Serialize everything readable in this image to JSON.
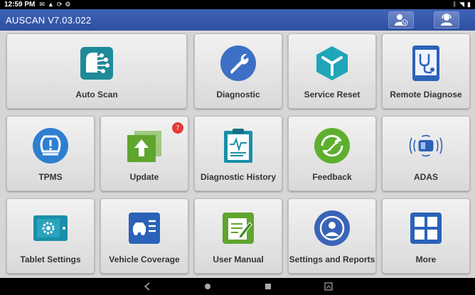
{
  "status_bar": {
    "time": "12:59 PM",
    "icons": [
      "mail-icon",
      "warning-icon",
      "sync-icon",
      "settings-icon"
    ],
    "right_icons": [
      "bluetooth-icon",
      "wifi-icon",
      "battery-icon"
    ]
  },
  "app": {
    "title": "AUSCAN V7.03.022",
    "accent": "#3b5cb0"
  },
  "tiles": [
    {
      "label": "Auto Scan",
      "icon": "auto-scan-icon"
    },
    {
      "label": "Diagnostic",
      "icon": "wrench-icon"
    },
    {
      "label": "Service Reset",
      "icon": "service-reset-icon"
    },
    {
      "label": "Remote Diagnose",
      "icon": "remote-diagnose-icon"
    },
    {
      "label": "TPMS",
      "icon": "tpms-icon"
    },
    {
      "label": "Update",
      "icon": "update-icon",
      "badge": "7"
    },
    {
      "label": "Diagnostic History",
      "icon": "clipboard-icon"
    },
    {
      "label": "Feedback",
      "icon": "feedback-icon"
    },
    {
      "label": "ADAS",
      "icon": "adas-icon"
    },
    {
      "label": "Tablet Settings",
      "icon": "tablet-settings-icon"
    },
    {
      "label": "Vehicle Coverage",
      "icon": "vehicle-coverage-icon"
    },
    {
      "label": "User Manual",
      "icon": "user-manual-icon"
    },
    {
      "label": "Settings and Reports",
      "icon": "settings-reports-icon"
    },
    {
      "label": "More",
      "icon": "grid-icon"
    }
  ]
}
